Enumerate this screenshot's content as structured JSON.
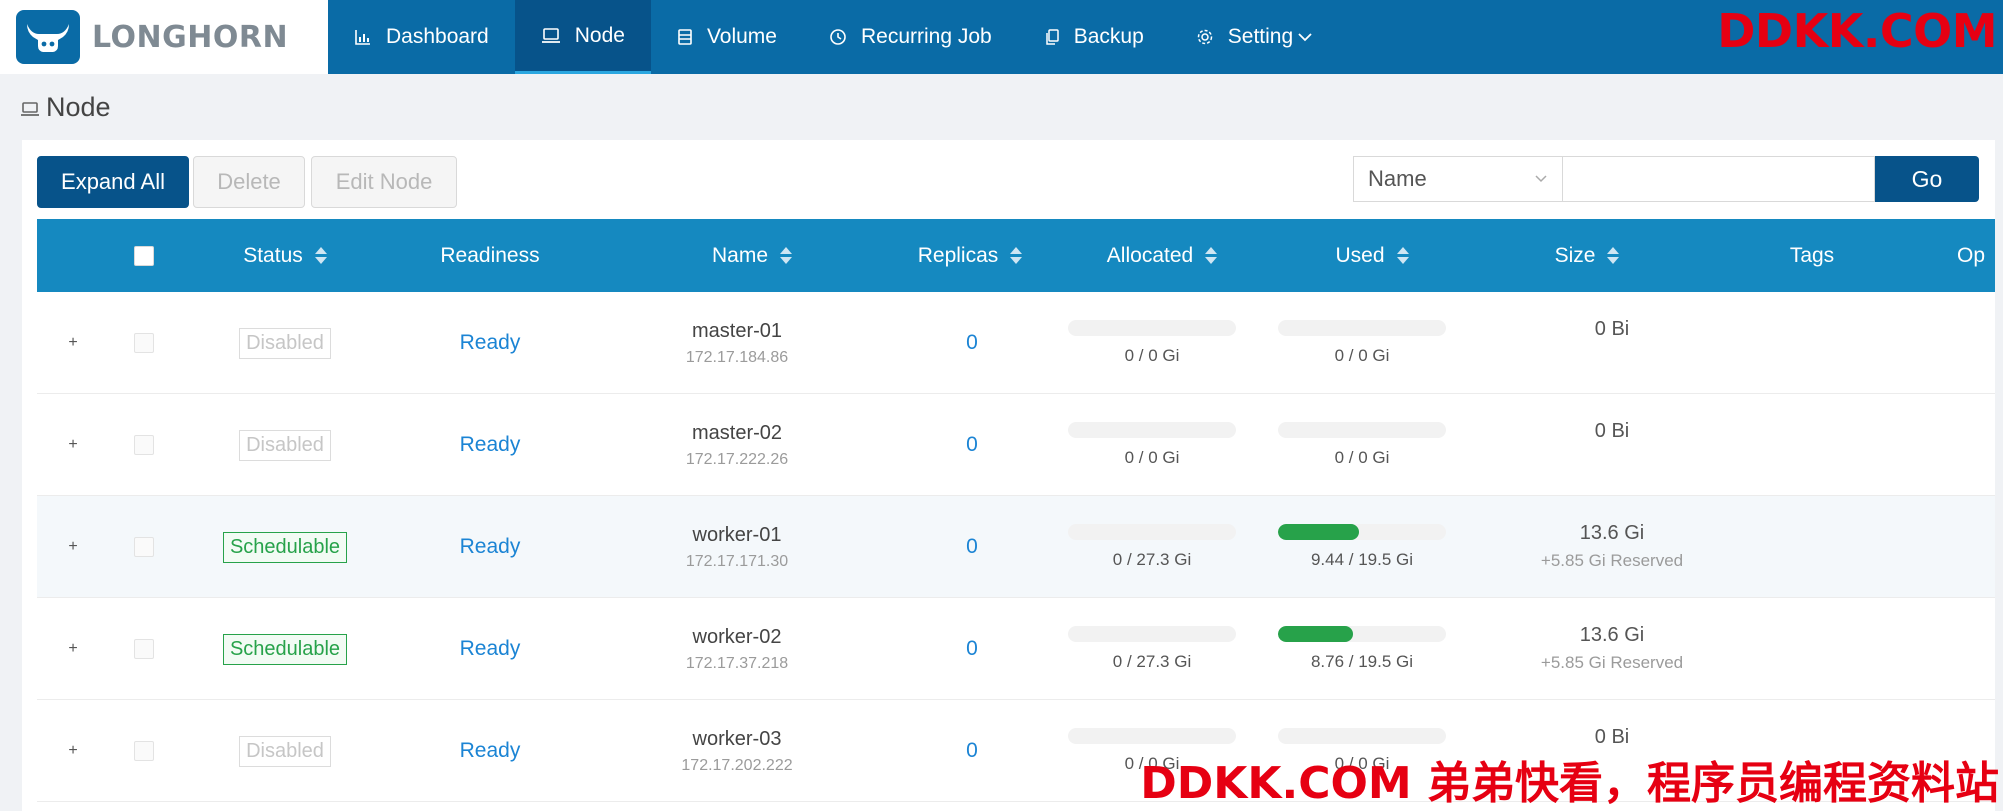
{
  "brand": {
    "name": "LONGHORN"
  },
  "nav": [
    {
      "label": "Dashboard",
      "icon": "bar-chart-icon"
    },
    {
      "label": "Node",
      "icon": "laptop-icon",
      "active": true
    },
    {
      "label": "Volume",
      "icon": "database-icon"
    },
    {
      "label": "Recurring Job",
      "icon": "clock-icon"
    },
    {
      "label": "Backup",
      "icon": "copy-icon"
    },
    {
      "label": "Setting",
      "icon": "gear-icon",
      "dropdown": true
    }
  ],
  "watermark": {
    "top": "DDKK.COM",
    "bottom": "DDKK.COM 弟弟快看，程序员编程资料站"
  },
  "page": {
    "title": "Node"
  },
  "toolbar": {
    "expand_all": "Expand All",
    "delete": "Delete",
    "edit_node": "Edit Node"
  },
  "search": {
    "field": "Name",
    "placeholder": "",
    "go": "Go"
  },
  "table": {
    "columns": {
      "status": "Status",
      "readiness": "Readiness",
      "name": "Name",
      "replicas": "Replicas",
      "allocated": "Allocated",
      "used": "Used",
      "size": "Size",
      "tags": "Tags",
      "operation": "Op"
    },
    "rows": [
      {
        "status": "Disabled",
        "readiness": "Ready",
        "name": "master-01",
        "ip": "172.17.184.86",
        "replicas": "0",
        "allocated": "0 / 0 Gi",
        "allocated_frac": 0,
        "used": "0 / 0 Gi",
        "used_frac": 0,
        "size": "0 Bi",
        "reserved": ""
      },
      {
        "status": "Disabled",
        "readiness": "Ready",
        "name": "master-02",
        "ip": "172.17.222.26",
        "replicas": "0",
        "allocated": "0 / 0 Gi",
        "allocated_frac": 0,
        "used": "0 / 0 Gi",
        "used_frac": 0,
        "size": "0 Bi",
        "reserved": ""
      },
      {
        "status": "Schedulable",
        "readiness": "Ready",
        "name": "worker-01",
        "ip": "172.17.171.30",
        "replicas": "0",
        "allocated": "0 / 27.3 Gi",
        "allocated_frac": 0,
        "used": "9.44 / 19.5 Gi",
        "used_frac": 0.484,
        "size": "13.6 Gi",
        "reserved": "+5.85 Gi Reserved"
      },
      {
        "status": "Schedulable",
        "readiness": "Ready",
        "name": "worker-02",
        "ip": "172.17.37.218",
        "replicas": "0",
        "allocated": "0 / 27.3 Gi",
        "allocated_frac": 0,
        "used": "8.76 / 19.5 Gi",
        "used_frac": 0.449,
        "size": "13.6 Gi",
        "reserved": "+5.85 Gi Reserved"
      },
      {
        "status": "Disabled",
        "readiness": "Ready",
        "name": "worker-03",
        "ip": "172.17.202.222",
        "replicas": "0",
        "allocated": "0 / 0 Gi",
        "allocated_frac": 0,
        "used": "0 / 0 Gi",
        "used_frac": 0,
        "size": "0 Bi",
        "reserved": ""
      }
    ]
  },
  "colors": {
    "header": "#0a6ba6",
    "active_nav": "#07538a",
    "table_header": "#1589c0",
    "primary": "#07538a",
    "success": "#27a24a",
    "link": "#1b84d4",
    "watermark": "#e60012"
  }
}
